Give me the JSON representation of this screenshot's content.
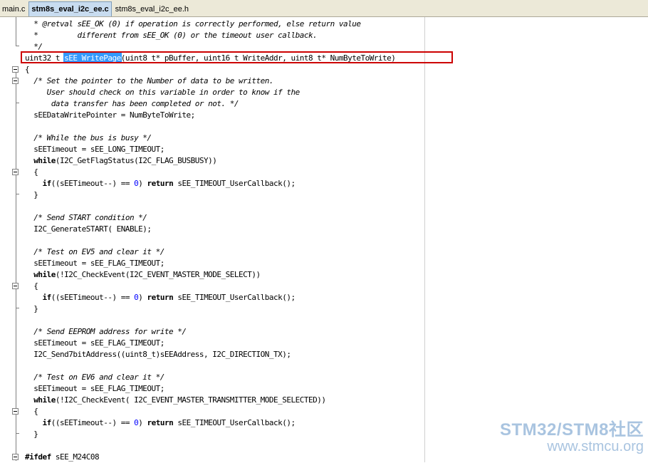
{
  "tabs": [
    {
      "label": "main.c",
      "active": false
    },
    {
      "label": "stm8s_eval_i2c_ee.c",
      "active": true
    },
    {
      "label": "stm8s_eval_i2c_ee.h",
      "active": false
    }
  ],
  "code": {
    "lines": [
      [
        {
          "t": "  * @retval sEE_OK (0) if operation is correctly performed, else return value",
          "c": "cm"
        }
      ],
      [
        {
          "t": "  *         different from sEE_OK (0) or the timeout user callback.",
          "c": "cm"
        }
      ],
      [
        {
          "t": "  */",
          "c": "cm"
        }
      ],
      [
        {
          "t": "uint32_t "
        },
        {
          "t": "sEE_WritePage",
          "c": "sel"
        },
        {
          "t": "(uint8_t* pBuffer, uint16_t WriteAddr, uint8_t* NumByteToWrite)"
        }
      ],
      [
        {
          "t": "{"
        }
      ],
      [
        {
          "t": "  /* Set the pointer to the Number of data to be written.",
          "c": "cm"
        }
      ],
      [
        {
          "t": "     User should check on this variable in order to know if the",
          "c": "cm"
        }
      ],
      [
        {
          "t": "      data transfer has been completed or not. */",
          "c": "cm"
        }
      ],
      [
        {
          "t": "  sEEDataWritePointer = NumByteToWrite;"
        }
      ],
      [
        {
          "t": ""
        }
      ],
      [
        {
          "t": "  /* While the bus is busy */",
          "c": "cm"
        }
      ],
      [
        {
          "t": "  sEETimeout = sEE_LONG_TIMEOUT;"
        }
      ],
      [
        {
          "t": "  "
        },
        {
          "t": "while",
          "c": "kw"
        },
        {
          "t": "(I2C_GetFlagStatus(I2C_FLAG_BUSBUSY))"
        }
      ],
      [
        {
          "t": "  {"
        }
      ],
      [
        {
          "t": "    "
        },
        {
          "t": "if",
          "c": "kw"
        },
        {
          "t": "((sEETimeout--) == "
        },
        {
          "t": "0",
          "c": "num"
        },
        {
          "t": ") "
        },
        {
          "t": "return",
          "c": "kw"
        },
        {
          "t": " sEE_TIMEOUT_UserCallback();"
        }
      ],
      [
        {
          "t": "  }"
        }
      ],
      [
        {
          "t": ""
        }
      ],
      [
        {
          "t": "  /* Send START condition */",
          "c": "cm"
        }
      ],
      [
        {
          "t": "  I2C_GenerateSTART( ENABLE);"
        }
      ],
      [
        {
          "t": ""
        }
      ],
      [
        {
          "t": "  /* Test on EV5 and clear it */",
          "c": "cm"
        }
      ],
      [
        {
          "t": "  sEETimeout = sEE_FLAG_TIMEOUT;"
        }
      ],
      [
        {
          "t": "  "
        },
        {
          "t": "while",
          "c": "kw"
        },
        {
          "t": "(!I2C_CheckEvent(I2C_EVENT_MASTER_MODE_SELECT))"
        }
      ],
      [
        {
          "t": "  {"
        }
      ],
      [
        {
          "t": "    "
        },
        {
          "t": "if",
          "c": "kw"
        },
        {
          "t": "((sEETimeout--) == "
        },
        {
          "t": "0",
          "c": "num"
        },
        {
          "t": ") "
        },
        {
          "t": "return",
          "c": "kw"
        },
        {
          "t": " sEE_TIMEOUT_UserCallback();"
        }
      ],
      [
        {
          "t": "  }"
        }
      ],
      [
        {
          "t": ""
        }
      ],
      [
        {
          "t": "  /* Send EEPROM address for write */",
          "c": "cm"
        }
      ],
      [
        {
          "t": "  sEETimeout = sEE_FLAG_TIMEOUT;"
        }
      ],
      [
        {
          "t": "  I2C_Send7bitAddress((uint8_t)sEEAddress, I2C_DIRECTION_TX);"
        }
      ],
      [
        {
          "t": ""
        }
      ],
      [
        {
          "t": "  /* Test on EV6 and clear it */",
          "c": "cm"
        }
      ],
      [
        {
          "t": "  sEETimeout = sEE_FLAG_TIMEOUT;"
        }
      ],
      [
        {
          "t": "  "
        },
        {
          "t": "while",
          "c": "kw"
        },
        {
          "t": "(!I2C_CheckEvent( I2C_EVENT_MASTER_TRANSMITTER_MODE_SELECTED))"
        }
      ],
      [
        {
          "t": "  {"
        }
      ],
      [
        {
          "t": "    "
        },
        {
          "t": "if",
          "c": "kw"
        },
        {
          "t": "((sEETimeout--) == "
        },
        {
          "t": "0",
          "c": "num"
        },
        {
          "t": ") "
        },
        {
          "t": "return",
          "c": "kw"
        },
        {
          "t": " sEE_TIMEOUT_UserCallback();"
        }
      ],
      [
        {
          "t": "  }"
        }
      ],
      [
        {
          "t": ""
        }
      ],
      [
        {
          "t": "#ifdef",
          "c": "kw"
        },
        {
          "t": " sEE_M24C08"
        }
      ]
    ]
  },
  "watermark": {
    "logo": "STM32/STM8社区",
    "url": "www.stmcu.org"
  },
  "colors": {
    "selection": "#3399ff",
    "highlight_box": "#cc0000",
    "number": "#0000ff",
    "watermark": "#a9c4e0"
  }
}
